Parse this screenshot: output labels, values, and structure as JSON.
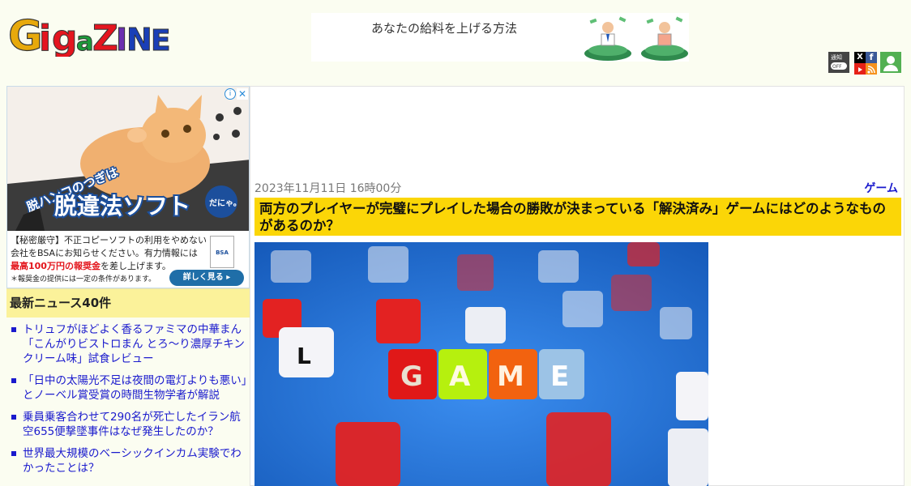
{
  "site": {
    "logo_text": "GigaziNE"
  },
  "ad_banner": {
    "text": "あなたの給料を上げる方法"
  },
  "header_icons": {
    "notify_label": "通知",
    "notify_sub": "OFF"
  },
  "left_ad": {
    "headline_small": "脱ハンコのつぎは",
    "headline_big": "脱違法ソフト",
    "headline_tag": "だにゃ。",
    "line1": "【秘密厳守】不正コピーソフトの利用をやめない",
    "line2": "会社をBSAにお知らせください。有力情報には",
    "line3_red": "最高100万円の報奨金",
    "line3_rest": "を差し上げます。",
    "note": "＊報奨金の提供には一定の条件があります。",
    "button": "詳しく見る",
    "badge": "BSA"
  },
  "news": {
    "header": "最新ニュース40件",
    "items": [
      "トリュフがほどよく香るファミマの中華まん「こんがりビストロまん とろ〜り濃厚チキンクリーム味」試食レビュー",
      "「日中の太陽光不足は夜間の電灯よりも悪い」とノーベル賞受賞の時間生物学者が解説",
      "乗員乗客合わせて290名が死亡したイラン航空655便撃墜事件はなぜ発生したのか？",
      "世界最大規模のベーシックインカム実験でわかったことは？"
    ]
  },
  "article": {
    "date": "2023年11月11日 16時00分",
    "category": "ゲーム",
    "title": "両方のプレイヤーが完璧にプレイした場合の勝敗が決まっている「解決済み」ゲームにはどのようなものがあるのか？"
  },
  "colors": {
    "title_bg": "#fbd607",
    "link": "#1a1acd",
    "news_header_bg": "#fbf29a"
  }
}
